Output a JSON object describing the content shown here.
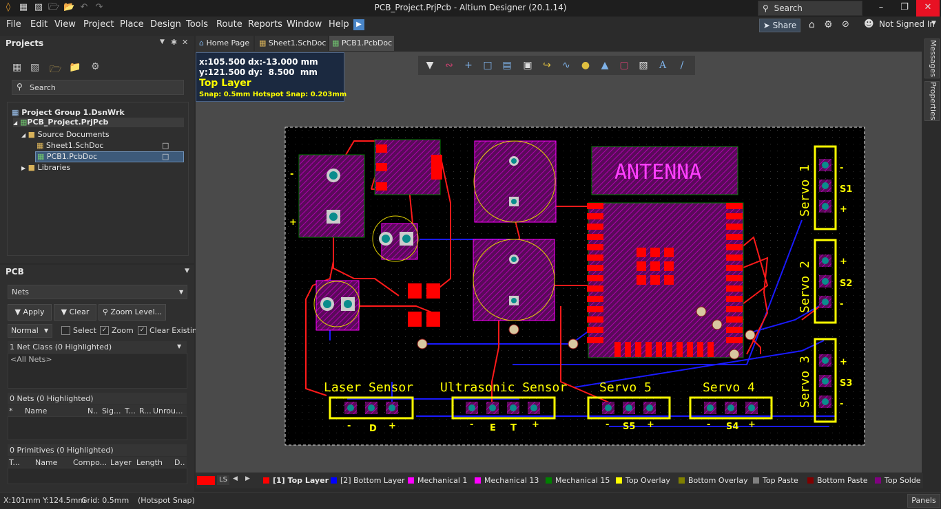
{
  "titlebar": {
    "title": "PCB_Project.PrjPcb - Altium Designer (20.1.14)",
    "search_placeholder": "Search"
  },
  "menu": [
    "File",
    "Edit",
    "View",
    "Project",
    "Place",
    "Design",
    "Tools",
    "Route",
    "Reports",
    "Window",
    "Help"
  ],
  "menu_right": {
    "share": "Share",
    "account": "Not Signed In"
  },
  "projects_panel": {
    "title": "Projects",
    "search_placeholder": "Search",
    "tree": {
      "group": "Project Group 1.DsnWrk",
      "project": "PCB_Project.PrjPcb",
      "source_docs": "Source Documents",
      "sheet": "Sheet1.SchDoc",
      "pcb": "PCB1.PcbDoc",
      "libraries": "Libraries"
    }
  },
  "pcb_panel": {
    "title": "PCB",
    "mode": "Nets",
    "apply": "Apply",
    "clear": "Clear",
    "zoom_level": "Zoom Level...",
    "highlight_mode": "Normal",
    "select": "Select",
    "zoom": "Zoom",
    "clear_existing": "Clear Existin",
    "net_class_header": "1 Net Class (0 Highlighted)",
    "net_class_item": "<All Nets>",
    "nets_header": "0 Nets (0 Highlighted)",
    "nets_columns": [
      "*",
      "Name",
      "N..",
      "Sig...",
      "T...",
      "R...",
      "Unrou..."
    ],
    "primitives_header": "0 Primitives (0 Highlighted)",
    "primitives_columns": [
      "T...",
      "Name",
      "Compo...",
      "Layer",
      "Length",
      "D.."
    ]
  },
  "doc_tabs": [
    "Home Page",
    "Sheet1.SchDoc",
    "PCB1.PcbDoc"
  ],
  "coord_box": {
    "x": "x:105.500",
    "dx": "dx:-13.000  mm",
    "y": "y:121.500",
    "dy": "dy:  8.500  mm",
    "layer": "Top Layer",
    "snap": "Snap: 0.5mm Hotspot Snap: 0.203mm"
  },
  "board_labels": {
    "antenna": "ANTENNA",
    "laser": "Laser  Sensor",
    "ultrasonic": "Ultrasonic  Sensor",
    "servo5": "Servo  5",
    "servo4": "Servo  4",
    "servo1": "Servo  1",
    "servo2": "Servo  2",
    "servo3": "Servo  3",
    "s1": "S1",
    "s2": "S2",
    "s3": "S3",
    "s4": "S4",
    "s5": "S5",
    "minus": "-",
    "plus": "+",
    "d": "D",
    "e": "E",
    "t": "T"
  },
  "layer_bar": {
    "ls": "LS",
    "layers": [
      {
        "name": "[1] Top Layer",
        "color": "#ff0000"
      },
      {
        "name": "[2] Bottom Layer",
        "color": "#0000ff"
      },
      {
        "name": "Mechanical 1",
        "color": "#ff00ff"
      },
      {
        "name": "Mechanical 13",
        "color": "#ff00ff"
      },
      {
        "name": "Mechanical 15",
        "color": "#008000"
      },
      {
        "name": "Top Overlay",
        "color": "#ffff00"
      },
      {
        "name": "Bottom Overlay",
        "color": "#808000"
      },
      {
        "name": "Top Paste",
        "color": "#808080"
      },
      {
        "name": "Bottom Paste",
        "color": "#800000"
      },
      {
        "name": "Top Solde",
        "color": "#800080"
      }
    ]
  },
  "statusbar": {
    "coords": "X:101mm Y:124.5mm",
    "grid": "Grid: 0.5mm",
    "snap": "(Hotspot Snap)",
    "panels": "Panels"
  },
  "right_tabs": [
    "Messages",
    "Properties"
  ]
}
